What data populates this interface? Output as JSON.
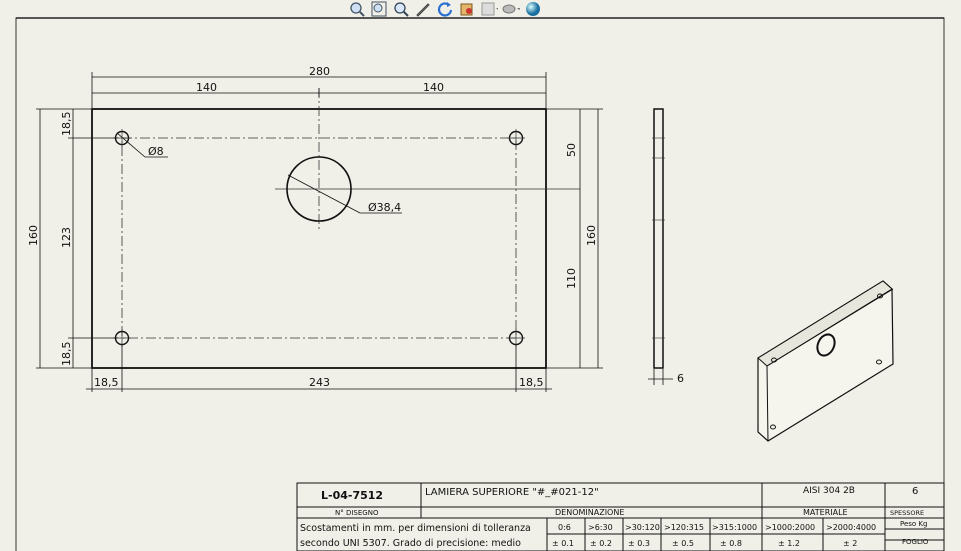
{
  "toolbar": {
    "icons": [
      "zoom-fit-icon",
      "zoom-area-icon",
      "zoom-icon",
      "pan-icon",
      "rotate-icon",
      "select-icon",
      "view-orientation-icon",
      "display-style-icon",
      "appearance-icon"
    ]
  },
  "drawing": {
    "dimensions": {
      "overall_width": "280",
      "half_left": "140",
      "half_right": "140",
      "height_left": "160",
      "hole_spacing_vertical": "123",
      "edge_top": "18,5",
      "edge_bottom": "18,5",
      "center_offset": "50",
      "lower_offset": "110",
      "height_right": "160",
      "edge_left": "18,5",
      "hole_spacing_horizontal": "243",
      "edge_right": "18,5",
      "small_hole": "Ø8",
      "large_hole": "Ø38,4",
      "thickness": "6"
    }
  },
  "title_block": {
    "drawing_number": "L-04-7512",
    "drawing_number_label": "N° DISEGNO",
    "name": "LAMIERA SUPERIORE \"#_#021-12\"",
    "name_label": "DENOMINAZIONE",
    "material": "AISI 304 2B",
    "material_label": "MATERIALE",
    "thickness_value": "6",
    "thickness_label": "SPESSORE",
    "weight_label": "Peso Kg",
    "sheet_label": "FOGLIO",
    "tolerance_note_line1": "Scostamenti in mm. per dimensioni di tolleranza",
    "tolerance_note_line2": "secondo UNI 5307. Grado di precisione: medio",
    "tolerance_ranges": [
      "0:6",
      ">6:30",
      ">30:120",
      ">120:315",
      ">315:1000",
      ">1000:2000",
      ">2000:4000"
    ],
    "tolerance_values": [
      "± 0.1",
      "± 0.2",
      "± 0.3",
      "± 0.5",
      "± 0.8",
      "± 1.2",
      "± 2"
    ]
  }
}
